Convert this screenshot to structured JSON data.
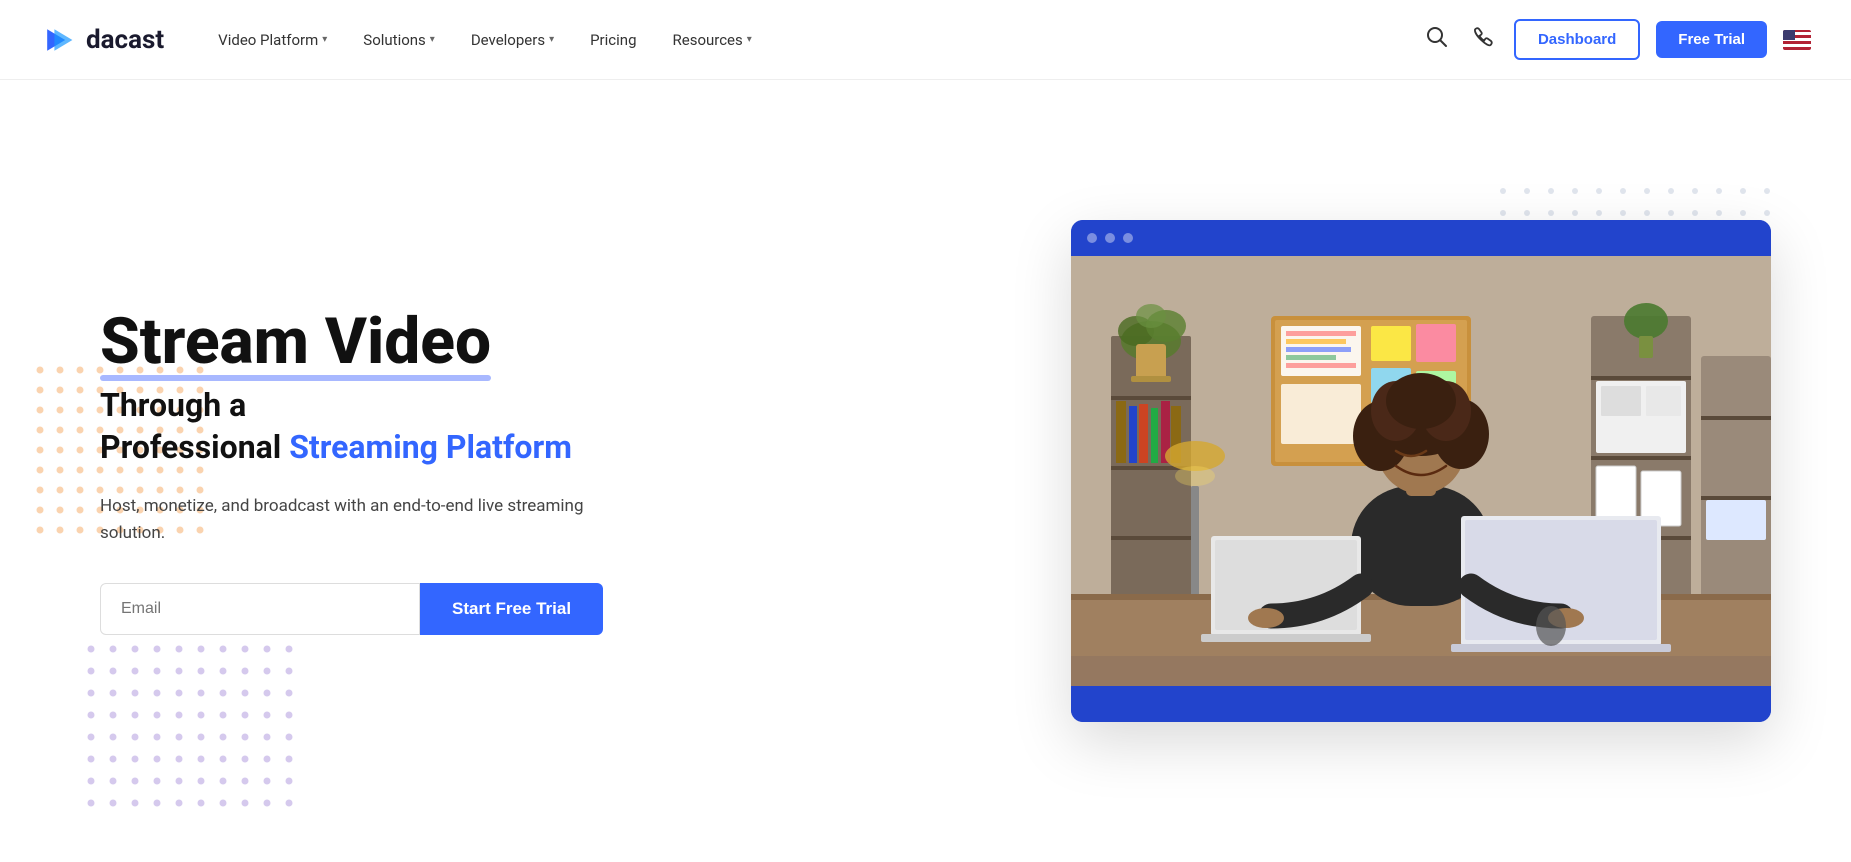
{
  "nav": {
    "logo_text": "dacast",
    "links": [
      {
        "label": "Video Platform",
        "has_dropdown": true
      },
      {
        "label": "Solutions",
        "has_dropdown": true
      },
      {
        "label": "Developers",
        "has_dropdown": true
      },
      {
        "label": "Pricing",
        "has_dropdown": false
      },
      {
        "label": "Resources",
        "has_dropdown": true
      }
    ],
    "dashboard_label": "Dashboard",
    "free_trial_label": "Free Trial"
  },
  "hero": {
    "title_line1": "Stream Video",
    "subtitle_part1": "Through a",
    "subtitle_part2": "Professional ",
    "subtitle_blue": "Streaming Platform",
    "description": "Host, monetize, and broadcast with an end-to-end live streaming solution.",
    "email_placeholder": "Email",
    "cta_label": "Start Free Trial"
  }
}
